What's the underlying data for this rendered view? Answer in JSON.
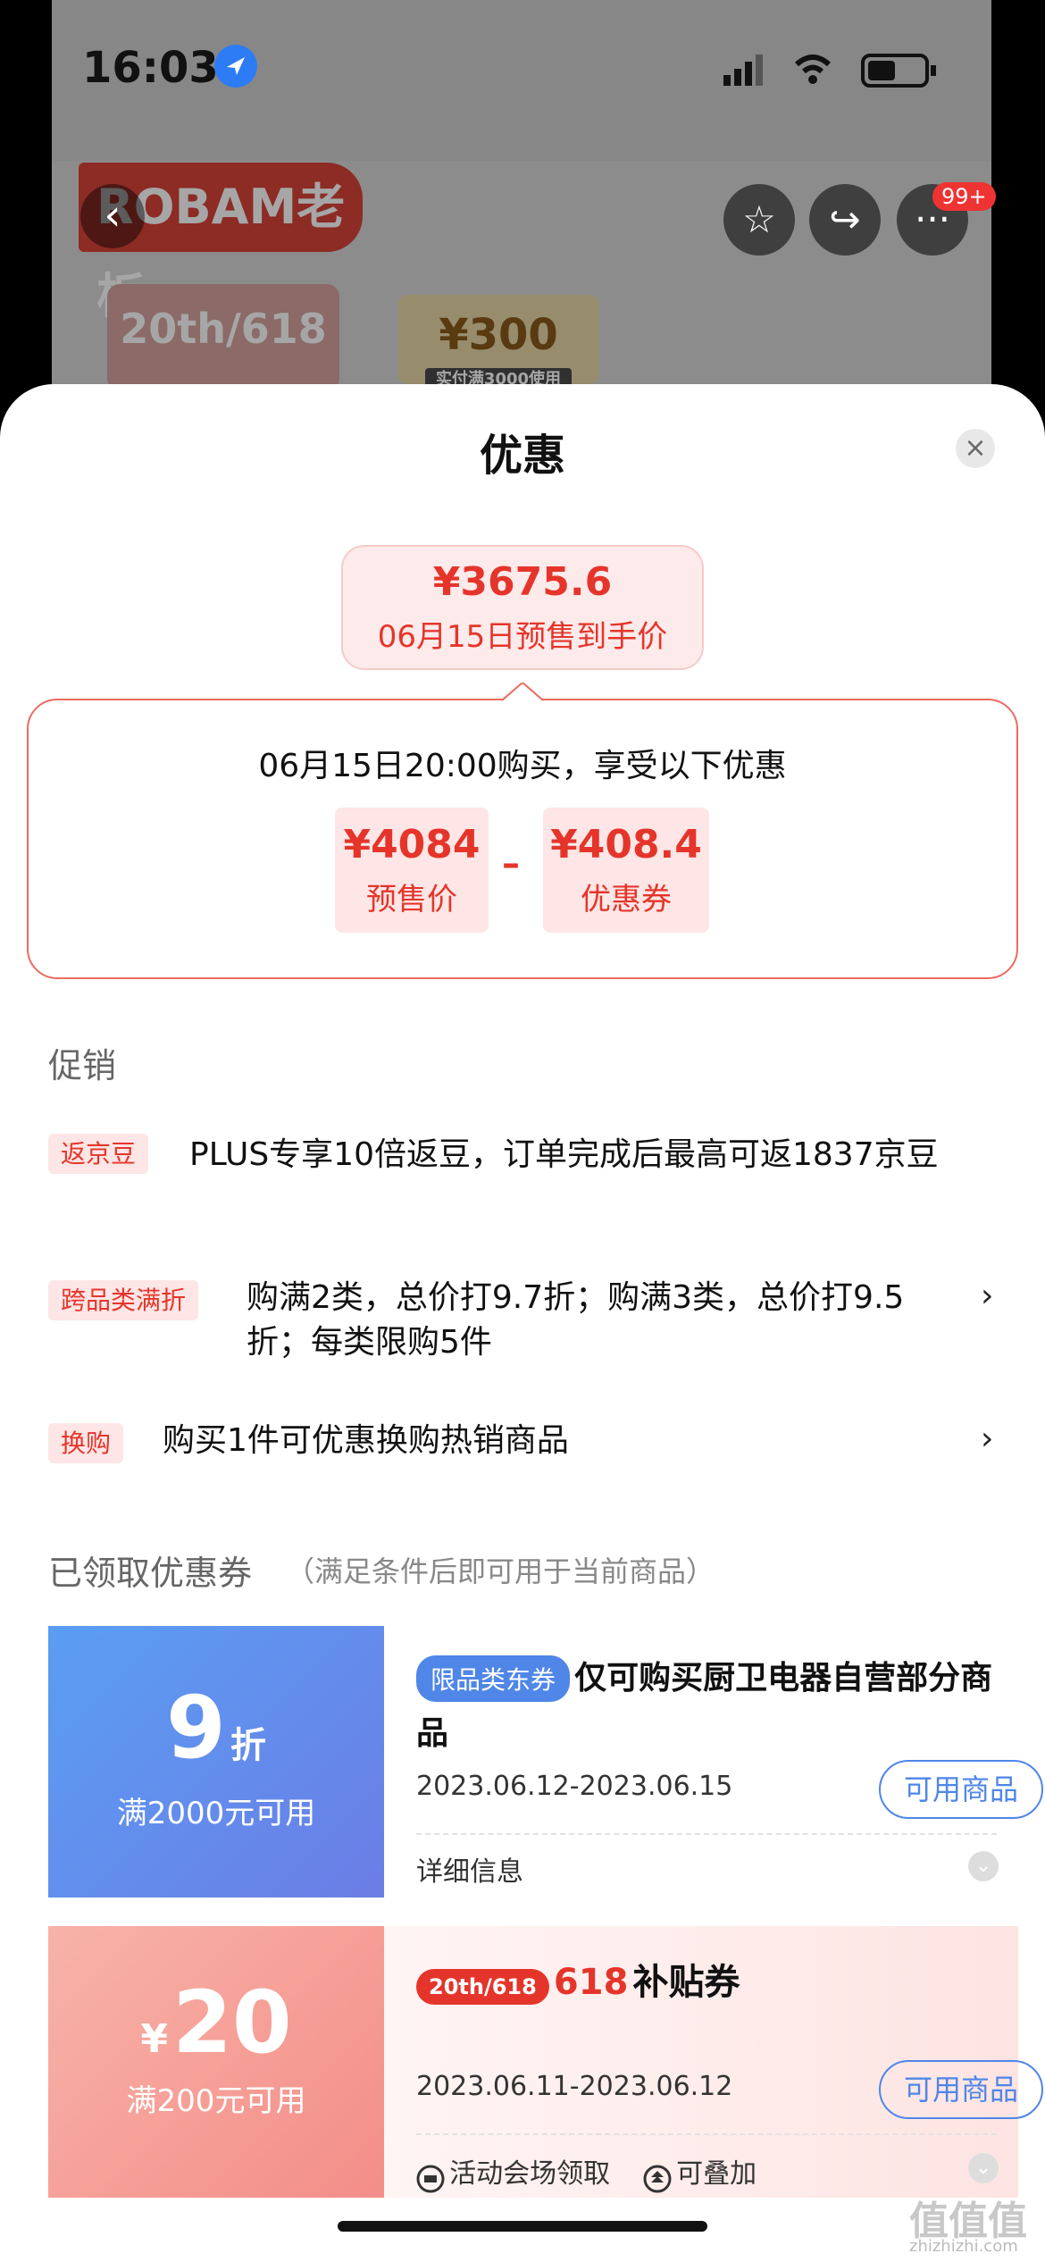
{
  "status_bar": {
    "time": "16:03",
    "location_icon": "location-arrow-icon"
  },
  "background_app": {
    "brand_text": "ROBAM老板",
    "back_label": "‹",
    "favorite_label": "☆",
    "share_label": "↪",
    "more_label": "···",
    "more_badge": "99+",
    "promo_badge": "20th/618",
    "coupon_value": "¥300",
    "coupon_condition": "实付满3000使用"
  },
  "sheet": {
    "title": "优惠",
    "close_label": "×",
    "final_price": "¥3675.6",
    "final_price_label": "06月15日预售到手价",
    "purchase_text": "06月15日20:00购买，享受以下优惠",
    "presale_value": "¥4084",
    "presale_label": "预售价",
    "minus": "–",
    "coupon_value": "¥408.4",
    "coupon_label": "优惠券"
  },
  "promotions": {
    "title": "促销",
    "items": [
      {
        "tag": "返京豆",
        "text": "PLUS专享10倍返豆，订单完成后最高可返1837京豆",
        "chevron": ""
      },
      {
        "tag": "跨品类满折",
        "text": "购满2类，总价打9.7折；购满3类，总价打9.5折；每类限购5件",
        "chevron": "›"
      },
      {
        "tag": "换购",
        "text": "购买1件可优惠换购热销商品",
        "chevron": "›"
      }
    ]
  },
  "claimed": {
    "title": "已领取优惠券",
    "hint": "（满足条件后即可用于当前商品）",
    "coupons": [
      {
        "amount": "9",
        "unit": "折",
        "condition": "满2000元可用",
        "tag": "限品类东券",
        "title": "仅可购买厨卫电器自营部分商品",
        "date": "2023.06.12-2023.06.15",
        "button": "可用商品",
        "more": "详细信息"
      },
      {
        "currency": "¥",
        "amount": "20",
        "condition": "满200元可用",
        "badge": "20th/618",
        "title_prefix": "618",
        "title": "补贴券",
        "date": "2023.06.11-2023.06.12",
        "button": "可用商品",
        "source": "活动会场领取",
        "stack": "可叠加"
      }
    ]
  },
  "watermark": {
    "main": "值值值",
    "sub": "zhizhizhi.com"
  },
  "colors": {
    "accent": "#e5352b",
    "blue": "#4f86e8"
  }
}
